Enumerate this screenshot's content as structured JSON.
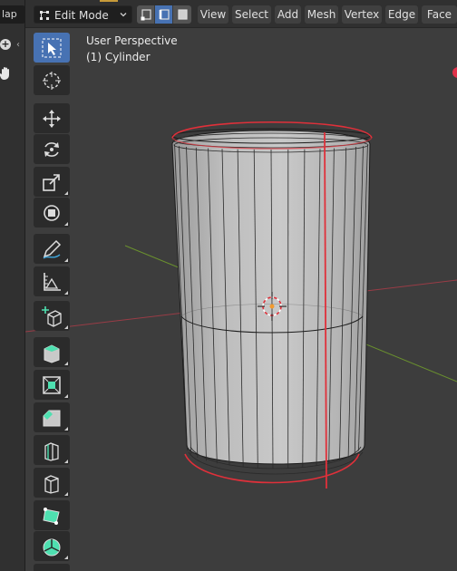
{
  "left_panel": {
    "tab_label": "lap",
    "icons": [
      "plus-icon",
      "hand-icon",
      "chevron-left-icon"
    ]
  },
  "header": {
    "mode": {
      "label": "Edit Mode",
      "icon": "edit-mode-icon"
    },
    "select_modes": [
      {
        "name": "vertex-select",
        "active": false
      },
      {
        "name": "edge-select",
        "active": true
      },
      {
        "name": "face-select",
        "active": false
      }
    ],
    "menus": [
      "View",
      "Select",
      "Add",
      "Mesh",
      "Vertex",
      "Edge",
      "Face"
    ]
  },
  "viewport": {
    "title": "User Perspective",
    "object": "(1) Cylinder"
  },
  "toolbar": {
    "tools": [
      {
        "name": "select-box-tool",
        "icon": "cursor-box-icon",
        "active": true
      },
      {
        "name": "cursor-tool",
        "icon": "crosshair-icon",
        "active": false
      },
      {
        "name": "move-tool",
        "icon": "move-arrows-icon",
        "active": false
      },
      {
        "name": "rotate-tool",
        "icon": "rotate-icon",
        "active": false
      },
      {
        "name": "scale-tool",
        "icon": "scale-icon",
        "active": false
      },
      {
        "name": "transform-tool",
        "icon": "transform-icon",
        "active": false
      },
      {
        "name": "annotate-tool",
        "icon": "pencil-icon",
        "active": false
      },
      {
        "name": "measure-tool",
        "icon": "ruler-icon",
        "active": false
      },
      {
        "name": "add-cube-tool",
        "icon": "add-cube-icon",
        "active": false
      },
      {
        "name": "extrude-tool",
        "icon": "extrude-icon",
        "active": false
      },
      {
        "name": "inset-tool",
        "icon": "inset-icon",
        "active": false
      },
      {
        "name": "bevel-tool",
        "icon": "bevel-icon",
        "active": false
      },
      {
        "name": "loop-cut-tool",
        "icon": "loop-cut-icon",
        "active": false
      },
      {
        "name": "knife-tool",
        "icon": "knife-icon",
        "active": false
      },
      {
        "name": "poly-build-tool",
        "icon": "poly-build-icon",
        "active": false
      },
      {
        "name": "spin-tool",
        "icon": "spin-icon",
        "active": false
      },
      {
        "name": "smooth-tool",
        "icon": "smooth-icon",
        "active": false
      }
    ]
  },
  "colors": {
    "active_blue": "#4772b3",
    "selection_red": "#e0303a",
    "grid_x_axis": "#a33c47",
    "grid_y_axis": "#6f9a2d",
    "background": "#3d3d3d"
  }
}
